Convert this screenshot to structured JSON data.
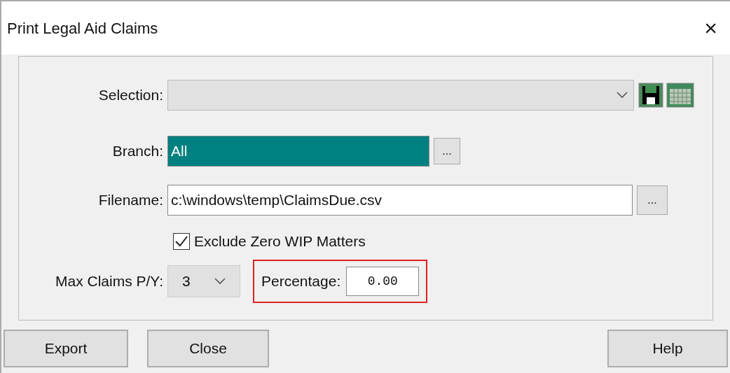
{
  "window": {
    "title": "Print Legal Aid Claims",
    "close": "×"
  },
  "selection": {
    "label": "Selection:"
  },
  "branch": {
    "label": "Branch:",
    "value": "All",
    "selected": true,
    "browse": "..."
  },
  "filename": {
    "label": "Filename:",
    "value": "c:\\windows\\temp\\ClaimsDue.csv",
    "browse": "..."
  },
  "exclude_zero_wip": {
    "label": "Exclude Zero WIP Matters",
    "checked": true
  },
  "max_claims": {
    "label": "Max Claims P/Y:",
    "value": "3"
  },
  "percentage": {
    "label": "Percentage:",
    "value": "0.00",
    "highlighted": true
  },
  "buttons": [
    "Export",
    "Close",
    "Help"
  ]
}
